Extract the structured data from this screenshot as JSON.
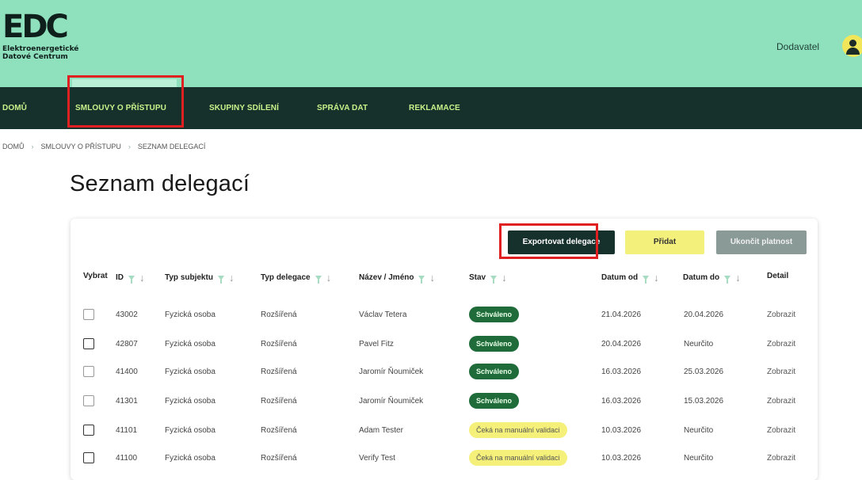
{
  "header": {
    "logo_text": "EDC",
    "logo_line1": "Elektroenergetické",
    "logo_line2": "Datové Centrum",
    "user_role": "Dodavatel"
  },
  "nav": {
    "items": [
      "DOMŮ",
      "SMLOUVY O PŘÍSTUPU",
      "SKUPINY SDÍLENÍ",
      "SPRÁVA DAT",
      "REKLAMACE"
    ]
  },
  "breadcrumb": [
    "DOMŮ",
    "SMLOUVY O PŘÍSTUPU",
    "SEZNAM DELEGACÍ"
  ],
  "page": {
    "title": "Seznam delegací"
  },
  "actions": {
    "export": "Exportovat delegace",
    "add": "Přidat",
    "end": "Ukončit platnost"
  },
  "table": {
    "columns": [
      "Vybrat",
      "ID",
      "Typ subjektu",
      "Typ delegace",
      "Název / Jméno",
      "Stav",
      "Datum od",
      "Datum do",
      "Detail"
    ],
    "rows": [
      {
        "id": "43002",
        "subject": "Fyzická osoba",
        "delegation": "Rozšířená",
        "name": "Václav Tetera",
        "status": "Schváleno",
        "status_kind": "ok",
        "from": "21.04.2026",
        "to": "20.04.2026",
        "detail": "Zobrazit"
      },
      {
        "id": "42807",
        "subject": "Fyzická osoba",
        "delegation": "Rozšířená",
        "name": "Pavel Fitz",
        "status": "Schváleno",
        "status_kind": "ok",
        "from": "20.04.2026",
        "to": "Neurčito",
        "detail": "Zobrazit"
      },
      {
        "id": "41400",
        "subject": "Fyzická osoba",
        "delegation": "Rozšířená",
        "name": "Jaromír Ňoumiček",
        "status": "Schváleno",
        "status_kind": "ok",
        "from": "16.03.2026",
        "to": "25.03.2026",
        "detail": "Zobrazit"
      },
      {
        "id": "41301",
        "subject": "Fyzická osoba",
        "delegation": "Rozšířená",
        "name": "Jaromír Ňoumiček",
        "status": "Schváleno",
        "status_kind": "ok",
        "from": "16.03.2026",
        "to": "15.03.2026",
        "detail": "Zobrazit"
      },
      {
        "id": "41101",
        "subject": "Fyzická osoba",
        "delegation": "Rozšířená",
        "name": "Adam Tester",
        "status": "Čeká na manuální validaci",
        "status_kind": "wait",
        "from": "10.03.2026",
        "to": "Neurčito",
        "detail": "Zobrazit"
      },
      {
        "id": "41100",
        "subject": "Fyzická osoba",
        "delegation": "Rozšířená",
        "name": "Verify Test",
        "status": "Čeká na manuální validaci",
        "status_kind": "wait",
        "from": "10.03.2026",
        "to": "Neurčito",
        "detail": "Zobrazit"
      }
    ]
  },
  "colors": {
    "header_bg": "#8fe0bd",
    "nav_bg": "#16302c",
    "nav_text": "#c9f28a",
    "approved": "#1f6b3a",
    "pending": "#f4f07a",
    "highlight": "#e02020"
  }
}
